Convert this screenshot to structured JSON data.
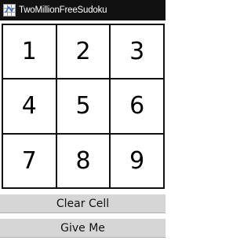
{
  "titlebar": {
    "app_icon": "sudoku-app-icon",
    "title": "TwoMillionFreeSudoku"
  },
  "keypad": {
    "digits": [
      "1",
      "2",
      "3",
      "4",
      "5",
      "6",
      "7",
      "8",
      "9"
    ]
  },
  "actions": {
    "clear_cell_label": "Clear Cell",
    "give_me_label": "Give Me"
  },
  "colors": {
    "titlebar_bg": "#111111",
    "grid_line": "#111111",
    "button_bg": "#d6d6d6"
  }
}
